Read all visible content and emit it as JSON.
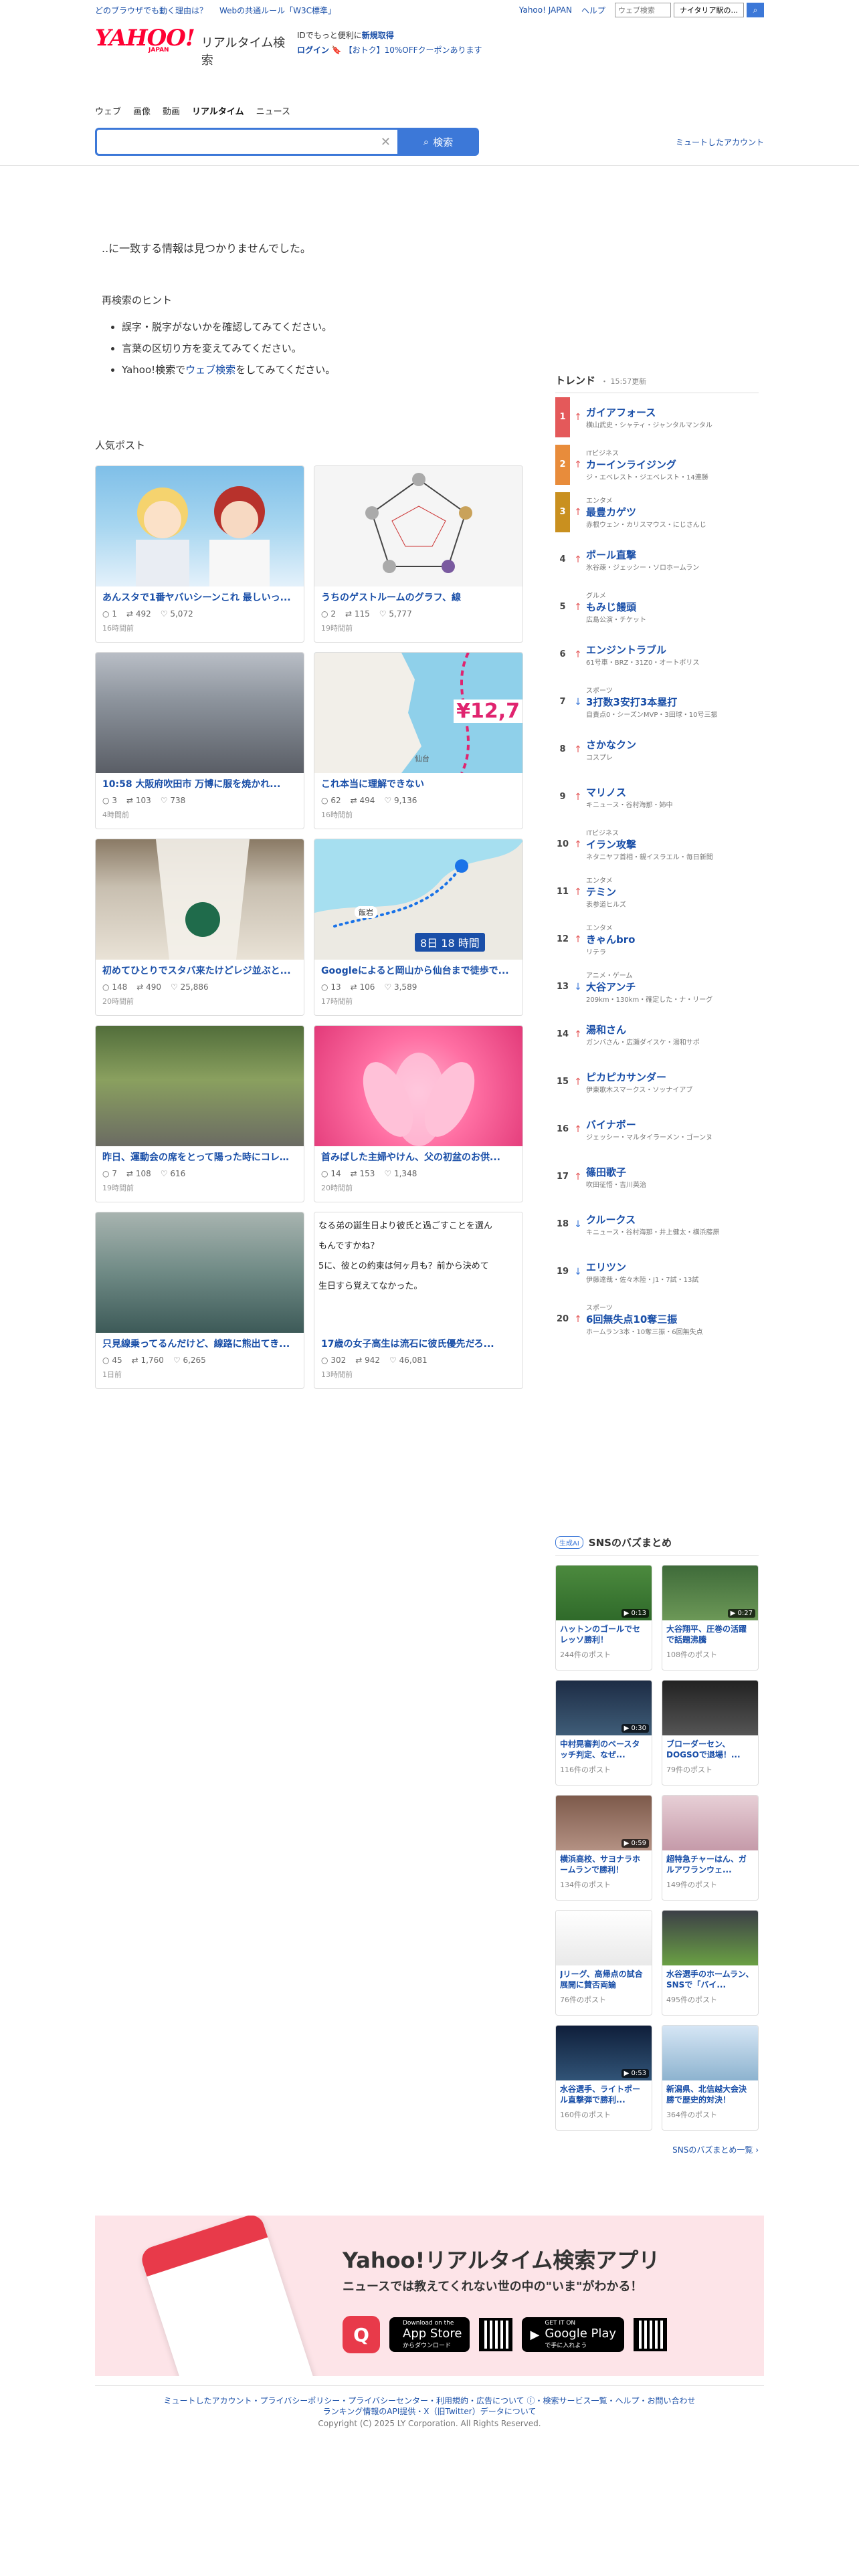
{
  "promo": {
    "link1": "どのブラウザでも動く理由は？",
    "link2": "Webの共通ルール「W3C標準」",
    "yahoo_japan": "Yahoo! JAPAN",
    "help": "ヘルプ",
    "mini_search_placeholder": "ウェブ検索",
    "mini_search_button": "ナイタリア駅の..."
  },
  "header": {
    "logo_main": "YAHOO!",
    "logo_sub": "JAPAN",
    "service_name": "リアルタイム検索",
    "id_prompt": "IDでもっと便利に",
    "signup": "新規取得",
    "login": "ログイン",
    "coupon": "【おトク】10%OFFクーポンあります"
  },
  "tabs": [
    "ウェブ",
    "画像",
    "動画",
    "リアルタイム",
    "ニュース"
  ],
  "search": {
    "value": "",
    "button": "検索",
    "muted_accounts": "ミュートしたアカウント"
  },
  "results": {
    "no_match": "..に一致する情報は見つかりませんでした。",
    "hint_title": "再検索のヒント",
    "hints": [
      "誤字・脱字がないかを確認してみてください。",
      "言葉の区切り方を変えてみてください。"
    ],
    "hint3_prefix": "Yahoo!検索で",
    "hint3_link": "ウェブ検索",
    "hint3_suffix": "をしてみてください。"
  },
  "popular": {
    "title": "人気ポスト",
    "posts": [
      {
        "title": "あんスタで1番ヤバいシーンこれ 最しいっ...",
        "replies": "1",
        "reposts": "492",
        "likes": "5,072",
        "time": "16時間前",
        "thumb": "th-anime"
      },
      {
        "title": "うちのゲストルームのグラフ、線",
        "replies": "2",
        "reposts": "115",
        "likes": "5,777",
        "time": "19時間前",
        "thumb": "th-radar"
      },
      {
        "title": "10:58 大阪府吹田市 万博に服を焼かれ...",
        "replies": "3",
        "reposts": "103",
        "likes": "738",
        "time": "4時間前",
        "thumb": "th-station"
      },
      {
        "title": "これ本当に理解できない",
        "replies": "62",
        "reposts": "494",
        "likes": "9,136",
        "time": "16時間前",
        "thumb": "th-map"
      },
      {
        "title": "初めてひとりでスタバ来たけどレジ並ぶと...",
        "replies": "148",
        "reposts": "490",
        "likes": "25,886",
        "time": "20時間前",
        "thumb": "th-cup"
      },
      {
        "title": "Googleによると岡山から仙台まで徒歩で...",
        "replies": "13",
        "reposts": "106",
        "likes": "3,589",
        "time": "17時間前",
        "thumb": "th-map2"
      },
      {
        "title": "昨日、運動会の席をとって陽った時にコレあっ...",
        "replies": "7",
        "reposts": "108",
        "likes": "616",
        "time": "19時間前",
        "thumb": "th-road"
      },
      {
        "title": "首みぱした主婦やけん、父の初盆のお供...",
        "replies": "14",
        "reposts": "153",
        "likes": "1,348",
        "time": "20時間前",
        "thumb": "th-lotus"
      },
      {
        "title": "只見線乗ってるんだけど、線路に熊出てき...",
        "replies": "45",
        "reposts": "1,760",
        "likes": "6,265",
        "time": "1日前",
        "thumb": "th-bridge"
      },
      {
        "title": "17歳の女子高生は流石に彼氏優先だろ...",
        "replies": "302",
        "reposts": "942",
        "likes": "46,081",
        "time": "13時間前",
        "thumb": "th-text"
      }
    ],
    "text_thumb_lines": [
      "なる弟の誕生日より彼氏と過ごすことを選ん",
      "もんですかね？",
      "5に、彼との約束は何ヶ月も？前から決めて",
      "生日すら覚えてなかった。"
    ],
    "map_label_1": "¥12,7",
    "map_label_2": "仙台",
    "map2_label": "8日 18 時間",
    "map2_tag": "飯岩"
  },
  "trend": {
    "title": "トレンド",
    "updated": "15:57更新",
    "items": [
      {
        "rank": "1",
        "dir": "up",
        "cat": "",
        "name": "ガイアフォース",
        "sub": "横山武史・シャティ・ジャンタルマンタル"
      },
      {
        "rank": "2",
        "dir": "up",
        "cat": "ITビジネス",
        "name": "カーインライジング",
        "sub": "ジ・エベレスト・ジエベレスト・14連勝"
      },
      {
        "rank": "3",
        "dir": "up",
        "cat": "エンタメ",
        "name": "最豊カゲツ",
        "sub": "赤根ウェン・カリスマウス・にじさんじ"
      },
      {
        "rank": "4",
        "dir": "up",
        "cat": "",
        "name": "ポール直撃",
        "sub": "氷谷疎・ジェッシー・ソロホームラン"
      },
      {
        "rank": "5",
        "dir": "up",
        "cat": "グルメ",
        "name": "もみじ饅頭",
        "sub": "広島公演・チケット"
      },
      {
        "rank": "6",
        "dir": "up",
        "cat": "",
        "name": "エンジントラブル",
        "sub": "61号車・BRZ・31Z0・オートポリス"
      },
      {
        "rank": "7",
        "dir": "down",
        "cat": "スポーツ",
        "name": "3打数3安打3本塁打",
        "sub": "自責点0・シーズンMVP・3田球・10号三振"
      },
      {
        "rank": "8",
        "dir": "up",
        "cat": "",
        "name": "さかなクン",
        "sub": "コスプレ"
      },
      {
        "rank": "9",
        "dir": "up",
        "cat": "",
        "name": "マリノス",
        "sub": "キニュース・谷村海那・姉中"
      },
      {
        "rank": "10",
        "dir": "up",
        "cat": "ITビジネス",
        "name": "イラン攻撃",
        "sub": "ネタニヤフ首相・親イスラエル・毎日新聞"
      },
      {
        "rank": "11",
        "dir": "up",
        "cat": "エンタメ",
        "name": "テミン",
        "sub": "表参道ヒルズ"
      },
      {
        "rank": "12",
        "dir": "up",
        "cat": "エンタメ",
        "name": "きゃんbro",
        "sub": "リテラ"
      },
      {
        "rank": "13",
        "dir": "down",
        "cat": "アニメ・ゲーム",
        "name": "大谷アンチ",
        "sub": "209km・130km・確定した・ナ・リーグ"
      },
      {
        "rank": "14",
        "dir": "up",
        "cat": "",
        "name": "湯和さん",
        "sub": "ガンバさん・広瀬ダイスケ・湯和サポ"
      },
      {
        "rank": "15",
        "dir": "up",
        "cat": "",
        "name": "ピカピカサンダー",
        "sub": "伊東歌木スマークス・ソッナイアブ"
      },
      {
        "rank": "16",
        "dir": "up",
        "cat": "",
        "name": "バイナボー",
        "sub": "ジェッシー・マルタイラーメン・ゴーンヌ"
      },
      {
        "rank": "17",
        "dir": "up",
        "cat": "",
        "name": "篠田歌子",
        "sub": "吹田征悟・吉川英治"
      },
      {
        "rank": "18",
        "dir": "down",
        "cat": "",
        "name": "クルークス",
        "sub": "キニュース・谷村海那・井上健太・横浜藤原"
      },
      {
        "rank": "19",
        "dir": "down",
        "cat": "",
        "name": "エリツン",
        "sub": "伊藤達哉・佐々木陸・J1・7試・13試"
      },
      {
        "rank": "20",
        "dir": "up",
        "cat": "スポーツ",
        "name": "6回無失点10奪三振",
        "sub": "ホームラン3本・10奪三振・6回無失点"
      }
    ]
  },
  "buzz": {
    "ai_badge": "生成AI",
    "title": "SNSのバズまとめ",
    "items": [
      {
        "title": "ハットンのゴールでセレッソ勝利！",
        "count": "244件のポスト",
        "dur": "0:13",
        "cls": "bz-green"
      },
      {
        "title": "大谷翔平、圧巻の活躍で話題沸騰",
        "count": "108件のポスト",
        "dur": "0:27",
        "cls": "bz-field"
      },
      {
        "title": "中村晃審判のベースタッチ判定、なぜ...",
        "count": "116件のポスト",
        "dur": "0:30",
        "cls": "bz-stadium"
      },
      {
        "title": "ブローダーセン、DOGSOで退場！...",
        "count": "79件のポスト",
        "dur": "",
        "cls": "bz-dark"
      },
      {
        "title": "横浜高校、サヨナラホームランで勝利！",
        "count": "134件のポスト",
        "dur": "0:59",
        "cls": "bz-crowd"
      },
      {
        "title": "超特急チャーはん、ガルアワランウェ...",
        "count": "149件のポスト",
        "dur": "",
        "cls": "bz-anime"
      },
      {
        "title": "Jリーグ、高帰点の試合展開に賛否両論",
        "count": "76件のポスト",
        "dur": "",
        "cls": "bz-news"
      },
      {
        "title": "水谷選手のホームラン、SNSで「バイ...",
        "count": "495件のポスト",
        "dur": "",
        "cls": "bz-park"
      },
      {
        "title": "水谷選手、ライトポール直撃弾で勝利...",
        "count": "160件のポスト",
        "dur": "0:53",
        "cls": "bz-night"
      },
      {
        "title": "新潟県、北信越大会決勝で歴史的対決！",
        "count": "364件のポスト",
        "dur": "",
        "cls": "bz-sky"
      }
    ],
    "more": "SNSのバズまとめ一覧"
  },
  "app": {
    "title": "Yahoo!リアルタイム検索アプリ",
    "subtitle": "ニュースでは教えてくれない世の中の\"いま\"がわかる！",
    "app_store_small": "Download on the",
    "app_store": "App Store",
    "app_store_jp": "からダウンロード",
    "google_small": "GET IT ON",
    "google_play": "Google Play",
    "google_jp": "で手に入れよう"
  },
  "footer": {
    "links_line1": "ミュートしたアカウント・プライバシーポリシー・プライバシーセンター・利用規約・広告について ⓘ・検索サービス一覧・ヘルプ・お問い合わせ",
    "links_line2": "ランキング情報のAPI提供・X（旧Twitter）データについて",
    "copyright": "Copyright (C) 2025 LY Corporation. All Rights Reserved."
  }
}
